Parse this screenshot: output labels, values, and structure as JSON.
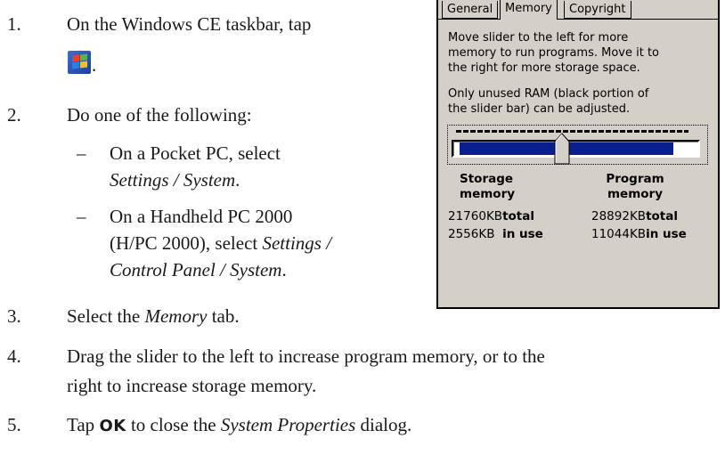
{
  "steps": [
    {
      "num": "1.",
      "text": "On the Windows CE taskbar, tap",
      "after_icon": "."
    },
    {
      "num": "2.",
      "text": "Do one of the following:"
    },
    {
      "num": "3.",
      "text_pre": "Select the ",
      "text_em": "Memory",
      "text_post": " tab."
    },
    {
      "num": "4.",
      "line1": "Drag the slider to the left to increase program memory, or to the",
      "line2": "right to increase storage memory."
    },
    {
      "num": "5.",
      "text_pre": "Tap ",
      "text_bold": "OK",
      "text_mid": " to close the ",
      "text_em": "System Properties",
      "text_post": " dialog."
    }
  ],
  "substeps": [
    {
      "dash": "–",
      "line1": "On a Pocket PC, select",
      "line2_em": "Settings / System",
      "line2_post": "."
    },
    {
      "dash": "–",
      "line1": "On a Handheld PC 2000",
      "line2_pre": "(H/PC 2000), select ",
      "line2_em": "Settings /",
      "line3_em": "Control Panel / System",
      "line3_post": "."
    }
  ],
  "icon": "windows-start-icon",
  "dialog": {
    "tabs": [
      "General",
      "Memory",
      "Copyright"
    ],
    "active_tab": "Memory",
    "para1": [
      "Move slider to the left for more",
      "memory to run programs. Move it to",
      "the right for more storage space."
    ],
    "para2": [
      "Only unused RAM (black portion of",
      "the slider bar) can be adjusted."
    ],
    "storage_label": [
      "Storage",
      "memory"
    ],
    "program_label": [
      "Program",
      "memory"
    ],
    "storage_total": "21760KB",
    "storage_inuse": "2556KB",
    "program_total": "28892KB",
    "program_inuse": "11044KB",
    "total_word": "total",
    "inuse_word": "in use",
    "slider_position": 0.43
  }
}
